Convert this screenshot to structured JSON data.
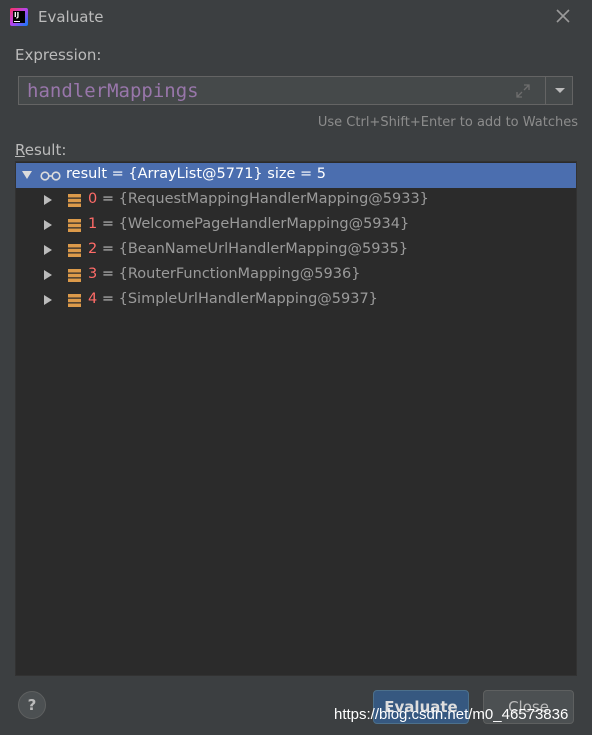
{
  "window": {
    "title": "Evaluate"
  },
  "expression": {
    "label": "Expression:",
    "value": "handlerMappings",
    "hint": "Use Ctrl+Shift+Enter to add to Watches"
  },
  "result": {
    "label_first": "R",
    "label_rest": "esult:",
    "root": {
      "name": "result",
      "eq": " = ",
      "value": "{ArrayList@5771}  size = 5"
    },
    "items": [
      {
        "index": "0",
        "eq": " = ",
        "value": "{RequestMappingHandlerMapping@5933}"
      },
      {
        "index": "1",
        "eq": " = ",
        "value": "{WelcomePageHandlerMapping@5934}"
      },
      {
        "index": "2",
        "eq": " = ",
        "value": "{BeanNameUrlHandlerMapping@5935}"
      },
      {
        "index": "3",
        "eq": " = ",
        "value": "{RouterFunctionMapping@5936}"
      },
      {
        "index": "4",
        "eq": " = ",
        "value": "{SimpleUrlHandlerMapping@5937}"
      }
    ]
  },
  "buttons": {
    "help": "?",
    "evaluate": "Evaluate",
    "close": "Close"
  },
  "watermark": "https://blog.csdn.net/m0_46573836",
  "colors": {
    "accent": "#4b6eaf",
    "index": "#ff6b68",
    "expression": "#9876aa"
  },
  "icons": {
    "root": "watch-glasses-icon",
    "item": "field-list-icon",
    "expand": "expand-icon",
    "dropdown": "chevron-down-icon"
  }
}
